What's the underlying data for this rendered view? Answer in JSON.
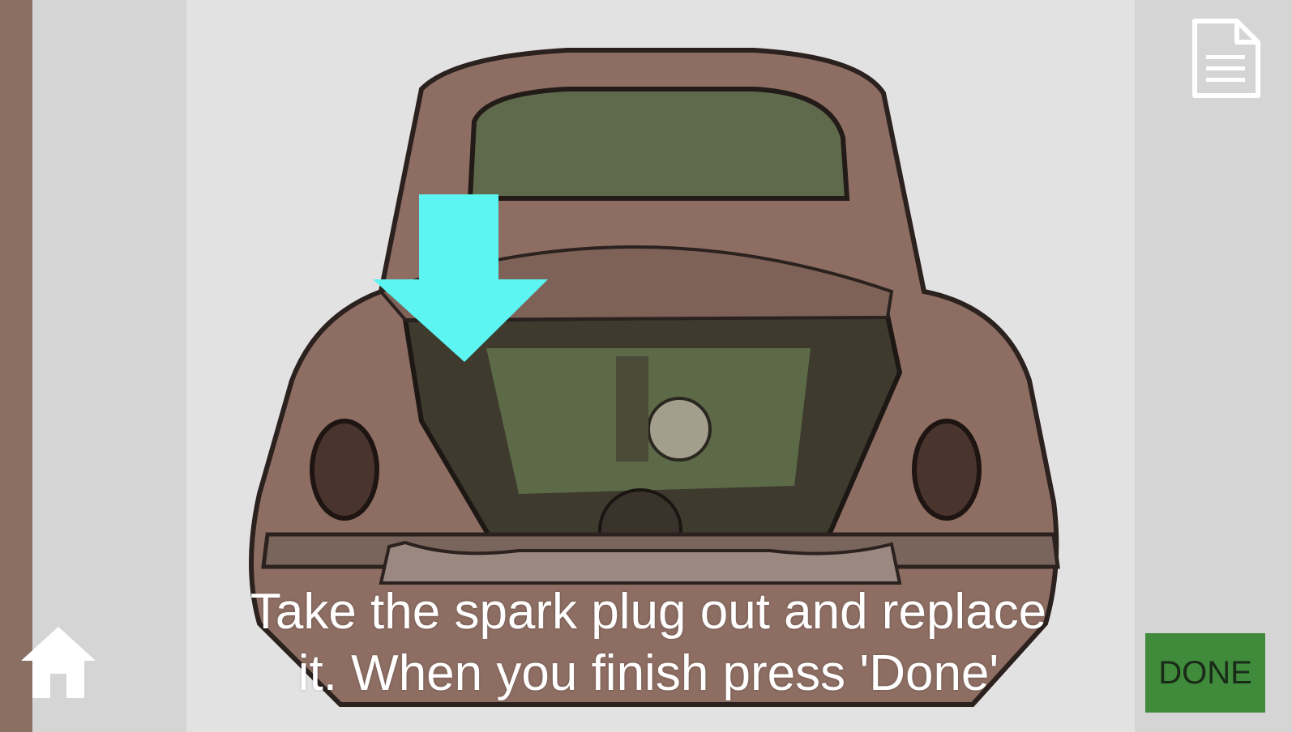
{
  "instruction": {
    "line1": "Take the spark plug out and replace",
    "line2": "it. When you finish press 'Done'"
  },
  "buttons": {
    "done_label": "DONE",
    "done_color": "#3f8a3b",
    "home_icon": "home-icon",
    "document_icon": "document-icon"
  },
  "overlay": {
    "arrow_icon": "down-arrow-icon",
    "arrow_color": "#5cf5f2"
  }
}
